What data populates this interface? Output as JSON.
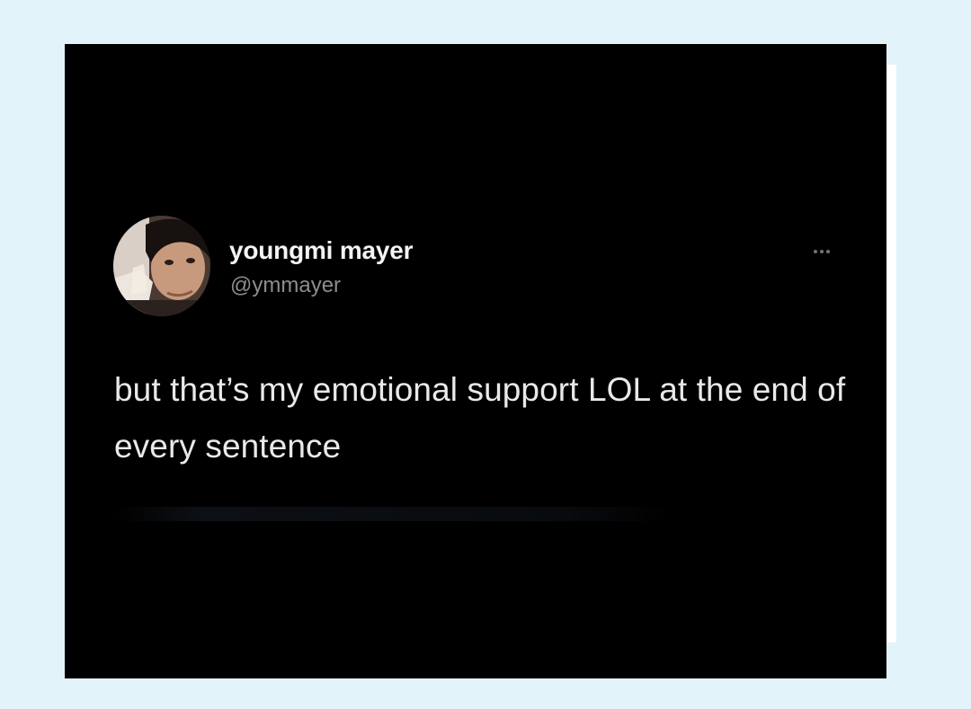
{
  "tweet": {
    "display_name": "youngmi mayer",
    "handle": "@ymmayer",
    "text": "but that’s my emotional support LOL at the end of every sentence",
    "more_icon": "more-horizontal-icon",
    "avatar_icon": "profile-photo"
  },
  "colors": {
    "page_background": "#e2f3f9",
    "card_background": "#000000",
    "name_text": "#f4f4f4",
    "handle_text": "#8a8d91",
    "body_text": "#e9e9e9"
  }
}
